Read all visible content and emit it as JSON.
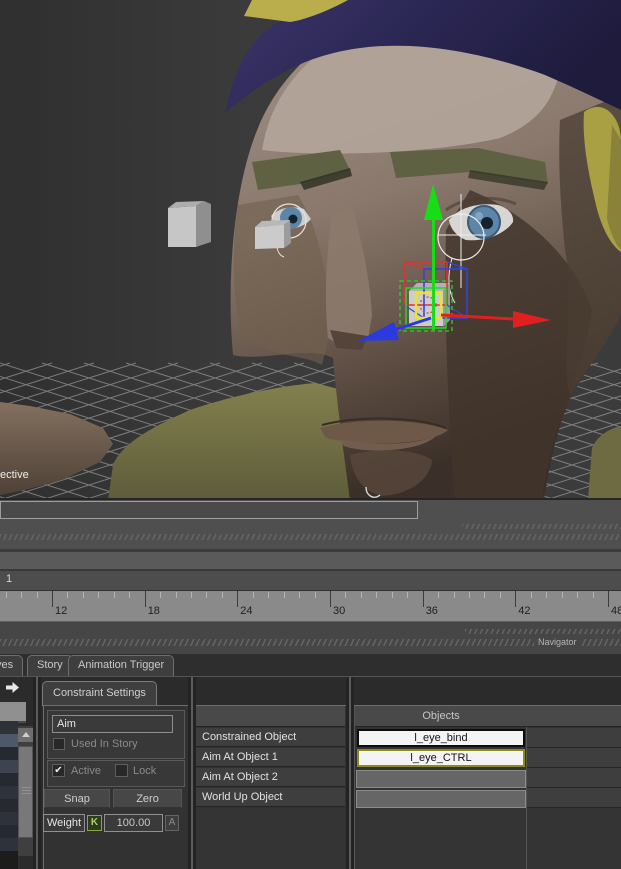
{
  "viewport": {
    "camera_label": "ective",
    "manipulator_colors": {
      "x_axis": "#e02020",
      "y_axis": "#17dd17",
      "z_axis": "#2a3ae0"
    },
    "selection_colors": {
      "selected_wire": "#2ad42a",
      "keyed_box": "#ece32b",
      "control_circle": "#ececec"
    }
  },
  "timeline": {
    "current_frame": "1",
    "frame_labels": [
      "12",
      "18",
      "24",
      "30",
      "36",
      "42",
      "48"
    ]
  },
  "navigator": {
    "label": "Navigator"
  },
  "tabs": [
    {
      "label": "ves"
    },
    {
      "label": "Story"
    },
    {
      "label": "Animation Trigger"
    }
  ],
  "left_tree": {
    "row_colors": [
      "#2d3138",
      "#4d5968",
      "#262a30",
      "#3c4452",
      "#262a30",
      "#2e333b",
      "#262a30",
      "#2e333b",
      "#262a30",
      "#2e333b"
    ]
  },
  "constraint_panel": {
    "tab_label": "Constraint Settings",
    "name_value": "Aim",
    "used_in_story_label": "Used In Story",
    "active_label": "Active",
    "lock_label": "Lock",
    "snap_label": "Snap",
    "zero_label": "Zero",
    "weight_label": "Weight",
    "weight_key_button": "K",
    "weight_value": "100.00",
    "weight_anim_button": "A",
    "checkbox_states": {
      "used_in_story": false,
      "active": true,
      "lock": false
    },
    "key_green": "#7fae3b"
  },
  "table": {
    "row_labels": [
      "Constrained Object",
      "Aim At Object 1",
      "Aim At Object 2",
      "World Up Object"
    ],
    "objects_header": "Objects",
    "objects": [
      {
        "value": "l_eye_bind",
        "border_color": "#0d0d0d",
        "bg": "#f4f4f4"
      },
      {
        "value": "l_eye_CTRL",
        "border_color": "#8f8a1e",
        "bg": "#f4f4f4"
      },
      {
        "value": "",
        "border_color": "#8b8b8b",
        "bg": "#666666"
      },
      {
        "value": "",
        "border_color": "#8b8b8b",
        "bg": "#666666"
      }
    ]
  }
}
